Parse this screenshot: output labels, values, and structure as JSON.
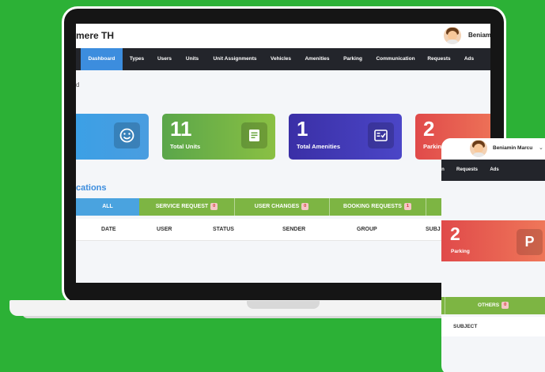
{
  "colors": {
    "background": "#2cb136",
    "nav_bg": "#23252b",
    "nav_active": "#3c8dde",
    "tabs_bg": "#7db543",
    "tab_active": "#4aa3df",
    "section_title": "#3c8dde"
  },
  "header": {
    "brand": "mere TH",
    "username": "Beniami",
    "avatar_icon": "user-avatar"
  },
  "nav": {
    "items": [
      {
        "label": "Dashboard",
        "active": true
      },
      {
        "label": "Types"
      },
      {
        "label": "Users"
      },
      {
        "label": "Units"
      },
      {
        "label": "Unit Assignments"
      },
      {
        "label": "Vehicles"
      },
      {
        "label": "Amenities"
      },
      {
        "label": "Parking"
      },
      {
        "label": "Communication"
      },
      {
        "label": "Requests"
      },
      {
        "label": "Ads"
      }
    ]
  },
  "breadcrumb": "d",
  "cards": [
    {
      "number": "",
      "label": "",
      "icon": "smiley-icon"
    },
    {
      "number": "11",
      "label": "Total Units",
      "icon": "document-icon"
    },
    {
      "number": "1",
      "label": "Total Amenities",
      "icon": "checklist-icon"
    },
    {
      "number": "2",
      "label": "Parkin",
      "icon": "parking-icon"
    }
  ],
  "notifications": {
    "title": "cations",
    "tabs": [
      {
        "label": "ALL",
        "active": true
      },
      {
        "label": "SERVICE REQUEST",
        "badge": "0"
      },
      {
        "label": "USER CHANGES",
        "badge": "0"
      },
      {
        "label": "BOOKING REQUESTS",
        "badge": "1"
      }
    ],
    "columns": [
      "DATE",
      "USER",
      "STATUS",
      "SENDER",
      "GROUP",
      "SUBJ"
    ]
  },
  "phone": {
    "username": "Beniamin Marcu",
    "nav_items": [
      "n",
      "Requests",
      "Ads"
    ],
    "card": {
      "number": "2",
      "label": "Parking",
      "icon_letter": "P"
    },
    "tab": {
      "label": "OTHERS",
      "badge": "0"
    },
    "column": "SUBJECT"
  }
}
